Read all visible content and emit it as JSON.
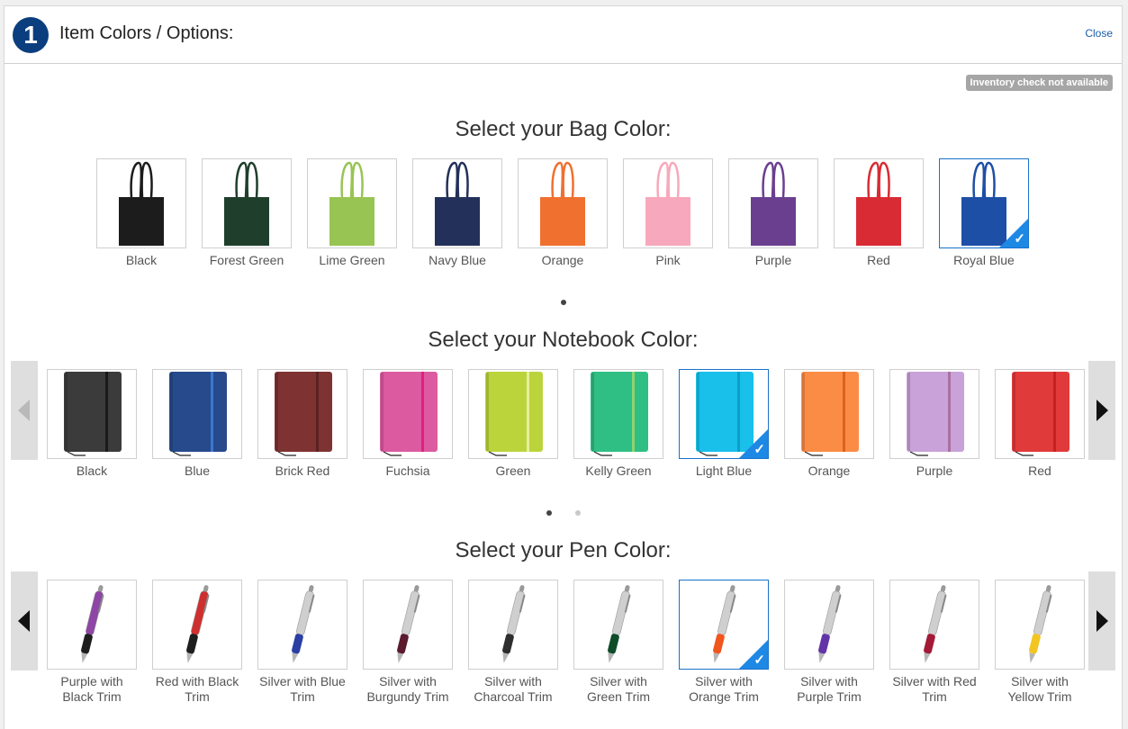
{
  "header": {
    "step_number": "1",
    "title": "Item Colors / Options:",
    "close_label": "Close"
  },
  "inventory_badge": "Inventory check not available",
  "accent_color": "#1e88e5",
  "bag": {
    "title": "Select your Bag Color:",
    "selected": "Royal Blue",
    "items": [
      {
        "label": "Black",
        "color": "#1c1c1c"
      },
      {
        "label": "Forest Green",
        "color": "#1f3f2c"
      },
      {
        "label": "Lime Green",
        "color": "#98c454"
      },
      {
        "label": "Navy Blue",
        "color": "#23305a"
      },
      {
        "label": "Orange",
        "color": "#f07030"
      },
      {
        "label": "Pink",
        "color": "#f8a8bc"
      },
      {
        "label": "Purple",
        "color": "#6b3f90"
      },
      {
        "label": "Red",
        "color": "#d92b34"
      },
      {
        "label": "Royal Blue",
        "color": "#1e4fa6"
      }
    ]
  },
  "notebook": {
    "title": "Select your Notebook Color:",
    "selected": "Light Blue",
    "items": [
      {
        "label": "Black",
        "color": "#3b3b3b",
        "band": "#1a1a1a"
      },
      {
        "label": "Blue",
        "color": "#274a8c",
        "band": "#3a78d0"
      },
      {
        "label": "Brick Red",
        "color": "#7e3232",
        "band": "#5c2222"
      },
      {
        "label": "Fuchsia",
        "color": "#dc5aa0",
        "band": "#e0217e"
      },
      {
        "label": "Green",
        "color": "#bcd43c",
        "band": "#e6ee9a"
      },
      {
        "label": "Kelly Green",
        "color": "#2fbf84",
        "band": "#8fd36f"
      },
      {
        "label": "Light Blue",
        "color": "#18c0ea",
        "band": "#0f9dc8"
      },
      {
        "label": "Orange",
        "color": "#fb8c45",
        "band": "#e0601e"
      },
      {
        "label": "Purple",
        "color": "#c8a2d8",
        "band": "#a8719f"
      },
      {
        "label": "Red",
        "color": "#e03a3a",
        "band": "#c42222"
      }
    ]
  },
  "pen": {
    "title": "Select your Pen Color:",
    "selected": "Silver with Orange Trim",
    "items": [
      {
        "label": "Purple with Black Trim",
        "barrel": "#8e45a6",
        "grip": "#1e1e1e"
      },
      {
        "label": "Red with Black Trim",
        "barrel": "#cf2f2f",
        "grip": "#1e1e1e"
      },
      {
        "label": "Silver with Blue Trim",
        "barrel": "#cfcfcf",
        "grip": "#2a3ea3"
      },
      {
        "label": "Silver with Burgundy Trim",
        "barrel": "#cfcfcf",
        "grip": "#5c1a2e"
      },
      {
        "label": "Silver with Charcoal Trim",
        "barrel": "#cfcfcf",
        "grip": "#2e2e2e"
      },
      {
        "label": "Silver with Green Trim",
        "barrel": "#cfcfcf",
        "grip": "#0f4d2a"
      },
      {
        "label": "Silver with Orange Trim",
        "barrel": "#cfcfcf",
        "grip": "#f0561e"
      },
      {
        "label": "Silver with Purple Trim",
        "barrel": "#cfcfcf",
        "grip": "#6234a8"
      },
      {
        "label": "Silver with Red Trim",
        "barrel": "#cfcfcf",
        "grip": "#a31a36"
      },
      {
        "label": "Silver with Yellow Trim",
        "barrel": "#cfcfcf",
        "grip": "#f3c521"
      }
    ]
  },
  "icons": {
    "selected_check": "checkmark-icon",
    "prev": "chevron-left-icon",
    "next": "chevron-right-icon"
  }
}
